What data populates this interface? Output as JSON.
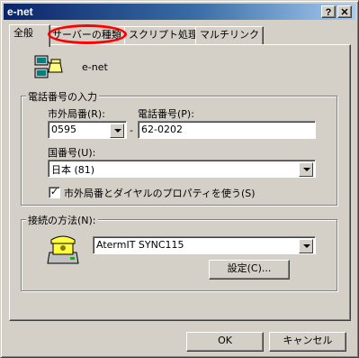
{
  "window": {
    "title": "e-net",
    "help_btn": "?",
    "close_btn": "✕"
  },
  "tabs": [
    "全般",
    "サーバーの種類",
    "スクリプト処理",
    "マルチリンク"
  ],
  "connection_name": "e-net",
  "phone_group": {
    "title": "電話番号の入力",
    "area_code_label": "市外局番(R):",
    "area_code_value": "0595",
    "dash": "-",
    "phone_label": "電話番号(P):",
    "phone_value": "62-0202",
    "country_label": "国番号(U):",
    "country_value": "日本 (81)",
    "use_country_label": "市外局番とダイヤルのプロパティを使う(S)",
    "use_country_checked": true
  },
  "connect_group": {
    "title": "接続の方法(N):",
    "device_value": "AtermIT SYNC115",
    "settings_button": "設定(C)..."
  },
  "footer": {
    "ok": "OK",
    "cancel": "キャンセル"
  }
}
